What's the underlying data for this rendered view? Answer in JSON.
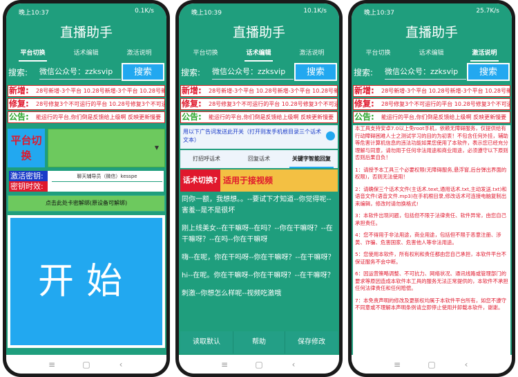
{
  "status": {
    "left": "晚上10:37",
    "right": "0.1K/s",
    "left_b": "晚上10:39",
    "right_b": "10.1K/s",
    "left_c": "晚上10:37",
    "right_c": "25.7K/s"
  },
  "app_title": "直播助手",
  "tabs": [
    "平台切换",
    "话术编辑",
    "激活说明"
  ],
  "search": {
    "label": "搜索:",
    "value": "微信公众号：zzksvip",
    "button": "搜索"
  },
  "notice": {
    "new_label": "新增:",
    "new_text": "28号新增-3个平台 10.28号新增-3个平台 10.28号新增-3个平台",
    "fix_label": "修复:",
    "fix_text": "28号修复3个不可运行的平台  10.28号修复3个不可运行的平台",
    "announce_label": "公告:",
    "announce_text_a": "能运行的平台,你们倒是反馈给上级啊  反映更新慢要",
    "announce_text_b": "能运行的平台,你们倒是反馈给上级啊 反映更新慢要"
  },
  "phone1": {
    "platform_switch": "平台切换",
    "platform_select": "请选择",
    "activation_key_label": "激活密钥:",
    "key_time_label": "密钥时效:",
    "key_input_placeholder": "聊天辅导员（微信）kesspe",
    "unbind_button": "点击此处卡密解绑(原设备可解绑)",
    "start_button": "开始"
  },
  "phone2": {
    "toggle_text": "用以下广告词发送此开关（打开则发手机根目录三个话术文本）",
    "subtabs": [
      "打招呼话术",
      "回复话术",
      "关键字智能回复"
    ],
    "switch_label": "话术切换?",
    "switch_value": "适用于接视频",
    "script_lines": [
      "同你一额，我想想。。--要试下才知道--你觉得呢--害羞--是不是很坏",
      "刚上线美女--在干嘛呀--在吗？--你在干嘛呀？--在干嘛呀？--在吗--你在干嘛呀",
      "嗨--在呢，你在干吗呀--你在干嘛呀？--在干嘛呀？",
      "hi--在呢。你在干嘛呀--你在干嘛呀？--在干嘛呀？",
      "刺激--你想怎么样呢--视频吃激哦"
    ],
    "buttons": [
      "读取默认",
      "帮助",
      "保存修改"
    ]
  },
  "phone3": {
    "paragraphs": [
      "本工具支持安卓7.0以上免root手机，依赖无障碍服务，仅提供给有行动障碍困难人士之测试学习的目的为初衷！不包含任何外挂，辅助等危害计算机信息的违法功能如果您使用了本软件，表示您已经充分理解与同意，请勿用于任何非法用途和商业用途，必须遵守以下原则否则后果自负！",
      "1：请授予本工具三个必要权限(无障碍服务,悬浮窗,后台弹出界面的权限)，否则无法使用！",
      "2：请确保三个话术文件(主话术.text,通用话术.txt,主动发送.txt)和语音文件(语音文件.mp3)在手机根目录,修改话术可连接电脑复制出来编辑，修改时请勿换格式!",
      "3：本软件出现问题，包括但不限于法律责任、软件异常，由您自己承担责任。",
      "4：您不得用于非法用途，商业用途，包括但不限于恶意注册、涉黄、诈骗、危害国家、危害他人等非法用途。",
      "5：您使用本软件，所有权利和责任都由您自己承担，本软件平台不保证服务不会中断。",
      "6：因运营策略调整、不可抗力、网络状况、通讯线路或管理部门的要求等原因造成本软件本工具的服务无法正常提供的，本软件不承担任何法律责任和任何赔偿。",
      "7：本免责声明的修改及更新权均属于本软件平台所有，如您不遵守不同意或不理解本声明条例请立即停止使用并卸载本软件，谢谢。"
    ]
  },
  "nav": {
    "menu": "≡",
    "home": "▢",
    "back": "‹"
  },
  "colors": {
    "primary": "#1f9e7d",
    "accent_blue": "#22a8f0",
    "red": "#e0182d",
    "green_btn": "#6dc95e",
    "yellow": "#f3c043"
  }
}
